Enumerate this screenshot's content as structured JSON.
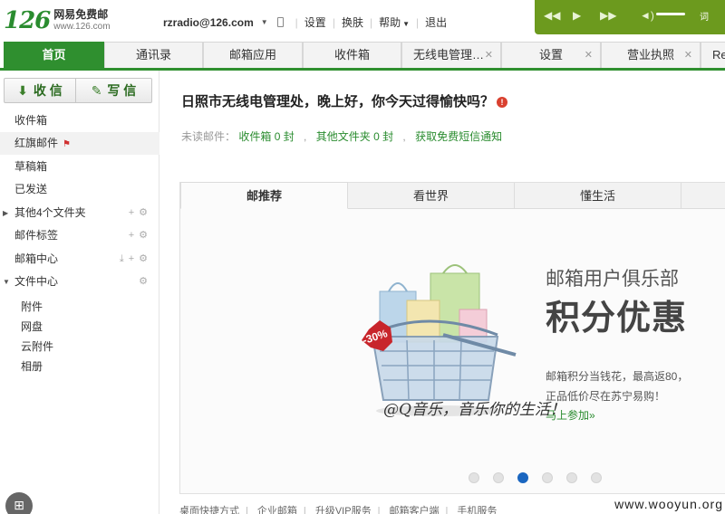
{
  "brand": {
    "logo_num": "126",
    "title": "网易免费邮",
    "url": "www.126.com",
    "accent_color": "#2f8f2f"
  },
  "topnav": {
    "email": "rzradio@126.com",
    "settings": "设置",
    "skin": "换肤",
    "help": "帮助",
    "logout": "退出"
  },
  "player": {
    "lyric": "词",
    "icons": [
      "prev-icon",
      "play-icon",
      "next-icon",
      "volume-icon"
    ]
  },
  "tabs": [
    {
      "label": "首页",
      "active": true
    },
    {
      "label": "通讯录"
    },
    {
      "label": "邮箱应用"
    },
    {
      "label": "收件箱"
    },
    {
      "label": "无线电管理…",
      "closable": true
    },
    {
      "label": "设置",
      "closable": true
    },
    {
      "label": "营业执照",
      "closable": true
    },
    {
      "label": "Re"
    }
  ],
  "sidebar": {
    "receive": "收 信",
    "write": "写 信",
    "folders": {
      "inbox": "收件箱",
      "flagged": "红旗邮件",
      "drafts": "草稿箱",
      "sent": "已发送",
      "other": "其他4个文件夹",
      "tags": "邮件标签",
      "center": "邮箱中心",
      "files": "文件中心"
    },
    "files_sub": {
      "attach": "附件",
      "disk": "网盘",
      "cloud": "云附件",
      "album": "相册"
    }
  },
  "main": {
    "greeting": "日照市无线电管理处，晚上好，你今天过得愉快吗？",
    "unread_label": "未读邮件：",
    "inbox_unread": "收件箱 0 封",
    "other_unread": "其他文件夹 0 封",
    "sms_link": "获取免费短信通知",
    "panel_tabs": [
      "邮推荐",
      "看世界",
      "懂生活"
    ],
    "promo": {
      "title": "邮箱用户俱乐部",
      "headline": "积分优惠",
      "desc1": "邮箱积分当钱花，最高返80，",
      "desc2": "正品低价尽在苏宁易购！",
      "link": "马上参加»",
      "badge": "-30%",
      "caption": "@Q音乐，音乐你的生活！",
      "active_dot_index": 2,
      "dot_count": 6
    }
  },
  "footer": {
    "links": [
      "桌面快捷方式",
      "企业邮箱",
      "升级VIP服务",
      "邮箱客户端",
      "手机服务"
    ],
    "site_mark": "www.wooyun.org"
  }
}
